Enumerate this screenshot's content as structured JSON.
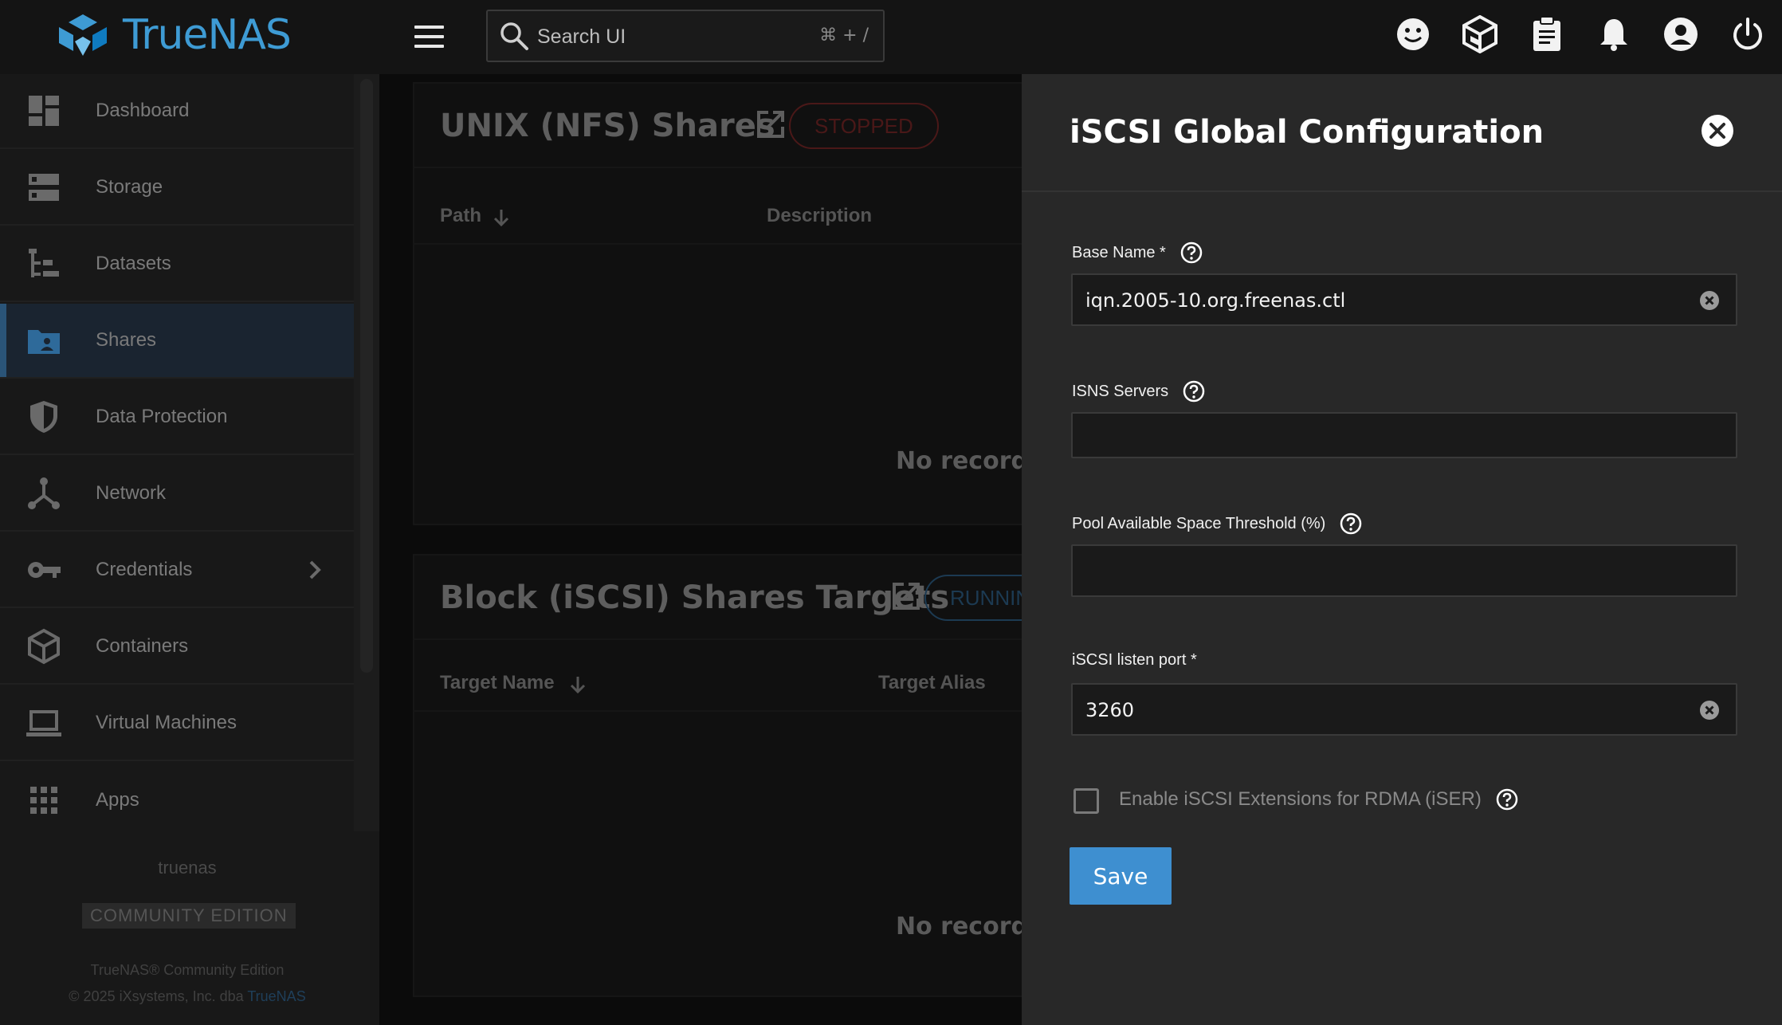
{
  "app": {
    "brand": "TrueNAS"
  },
  "topbar": {
    "search_placeholder": "Search UI",
    "search_shortcut": "⌘ + /",
    "icons": [
      "smiley-icon",
      "truecommand-icon",
      "clipboard-icon",
      "bell-icon",
      "account-icon",
      "power-icon"
    ]
  },
  "sidebar": {
    "items": [
      {
        "label": "Dashboard",
        "icon": "dashboard-icon"
      },
      {
        "label": "Storage",
        "icon": "storage-icon"
      },
      {
        "label": "Datasets",
        "icon": "datasets-icon"
      },
      {
        "label": "Shares",
        "icon": "shares-icon",
        "active": true
      },
      {
        "label": "Data Protection",
        "icon": "shield-icon"
      },
      {
        "label": "Network",
        "icon": "network-icon"
      },
      {
        "label": "Credentials",
        "icon": "key-icon"
      },
      {
        "label": "Containers",
        "icon": "cube-icon"
      },
      {
        "label": "Virtual Machines",
        "icon": "laptop-icon"
      },
      {
        "label": "Apps",
        "icon": "apps-grid-icon"
      }
    ],
    "hostname": "truenas",
    "edition": "COMMUNITY EDITION",
    "copyright_line1": "TrueNAS® Community Edition",
    "copyright_line2_prefix": "© 2025 iXsystems, Inc. dba ",
    "copyright_link": "TrueNAS"
  },
  "main": {
    "nfs_card": {
      "title": "UNIX (NFS) Shares",
      "status": "STOPPED",
      "col_path": "Path",
      "col_description": "Description",
      "empty": "No records"
    },
    "iscsi_card": {
      "title": "Block (iSCSI) Shares Targets",
      "status": "RUNNING",
      "col_target_name": "Target Name",
      "col_target_alias": "Target Alias",
      "empty": "No records"
    }
  },
  "dialog": {
    "title": "iSCSI Global Configuration",
    "base_name_label": "Base Name *",
    "base_name_value": "iqn.2005-10.org.freenas.ctl",
    "isns_label": "ISNS Servers",
    "isns_value": "",
    "pool_threshold_label": "Pool Available Space Threshold (%)",
    "pool_threshold_value": "",
    "listen_port_label": "iSCSI listen port *",
    "listen_port_value": "3260",
    "iser_label": "Enable iSCSI Extensions for RDMA (iSER)",
    "iser_checked": false,
    "save_label": "Save"
  },
  "colors": {
    "accent": "#3e8fd0",
    "brand": "#3e9bd4",
    "panel_bg": "#282828",
    "stopped": "#4a1818",
    "running": "#1c3a52"
  }
}
